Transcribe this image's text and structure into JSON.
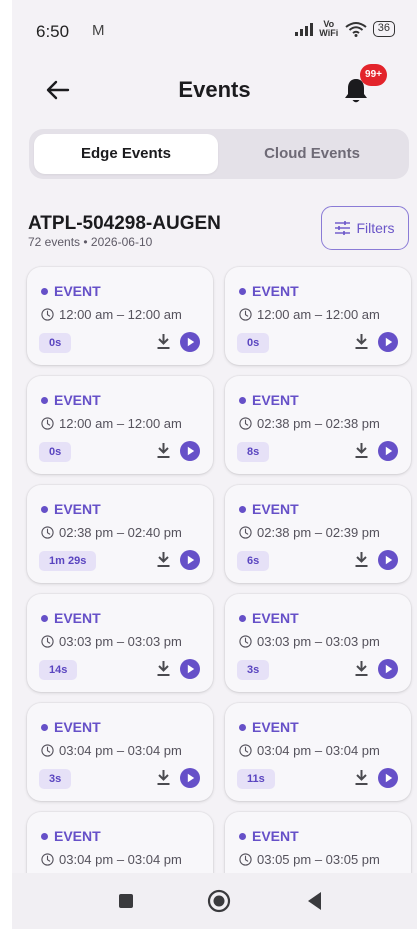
{
  "status_bar": {
    "time": "6:50",
    "mail_glyph": "M",
    "network_label": "Vo WiFi",
    "battery": "36"
  },
  "header": {
    "title": "Events",
    "notification_badge": "99+"
  },
  "tabs": [
    {
      "label": "Edge Events",
      "active": true
    },
    {
      "label": "Cloud Events",
      "active": false
    }
  ],
  "device": {
    "name": "ATPL-504298-AUGEN",
    "meta": "72 events • 2026-06-10",
    "filters_label": "Filters"
  },
  "events": [
    {
      "label": "EVENT",
      "time": "12:00 am – 12:00 am",
      "duration": "0s"
    },
    {
      "label": "EVENT",
      "time": "12:00 am – 12:00 am",
      "duration": "0s"
    },
    {
      "label": "EVENT",
      "time": "12:00 am – 12:00 am",
      "duration": "0s"
    },
    {
      "label": "EVENT",
      "time": "02:38 pm – 02:38 pm",
      "duration": "8s"
    },
    {
      "label": "EVENT",
      "time": "02:38 pm – 02:40 pm",
      "duration": "1m 29s"
    },
    {
      "label": "EVENT",
      "time": "02:38 pm – 02:39 pm",
      "duration": "6s"
    },
    {
      "label": "EVENT",
      "time": "03:03 pm – 03:03 pm",
      "duration": "14s"
    },
    {
      "label": "EVENT",
      "time": "03:03 pm – 03:03 pm",
      "duration": "3s"
    },
    {
      "label": "EVENT",
      "time": "03:04 pm – 03:04 pm",
      "duration": "3s"
    },
    {
      "label": "EVENT",
      "time": "03:04 pm – 03:04 pm",
      "duration": "11s"
    },
    {
      "label": "EVENT",
      "time": "03:04 pm – 03:04 pm",
      "duration": ""
    },
    {
      "label": "EVENT",
      "time": "03:05 pm – 03:05 pm",
      "duration": ""
    }
  ],
  "icons": {
    "back": "arrow-left-icon",
    "bell": "bell-icon",
    "filters": "sliders-icon",
    "clock": "clock-icon",
    "download": "download-icon",
    "play": "play-circle-icon",
    "nav_recents": "square-icon",
    "nav_home": "circle-icon",
    "nav_back": "triangle-back-icon"
  },
  "colors": {
    "accent": "#6650c8",
    "badge": "#e3242b",
    "background": "#f4f2f6"
  }
}
